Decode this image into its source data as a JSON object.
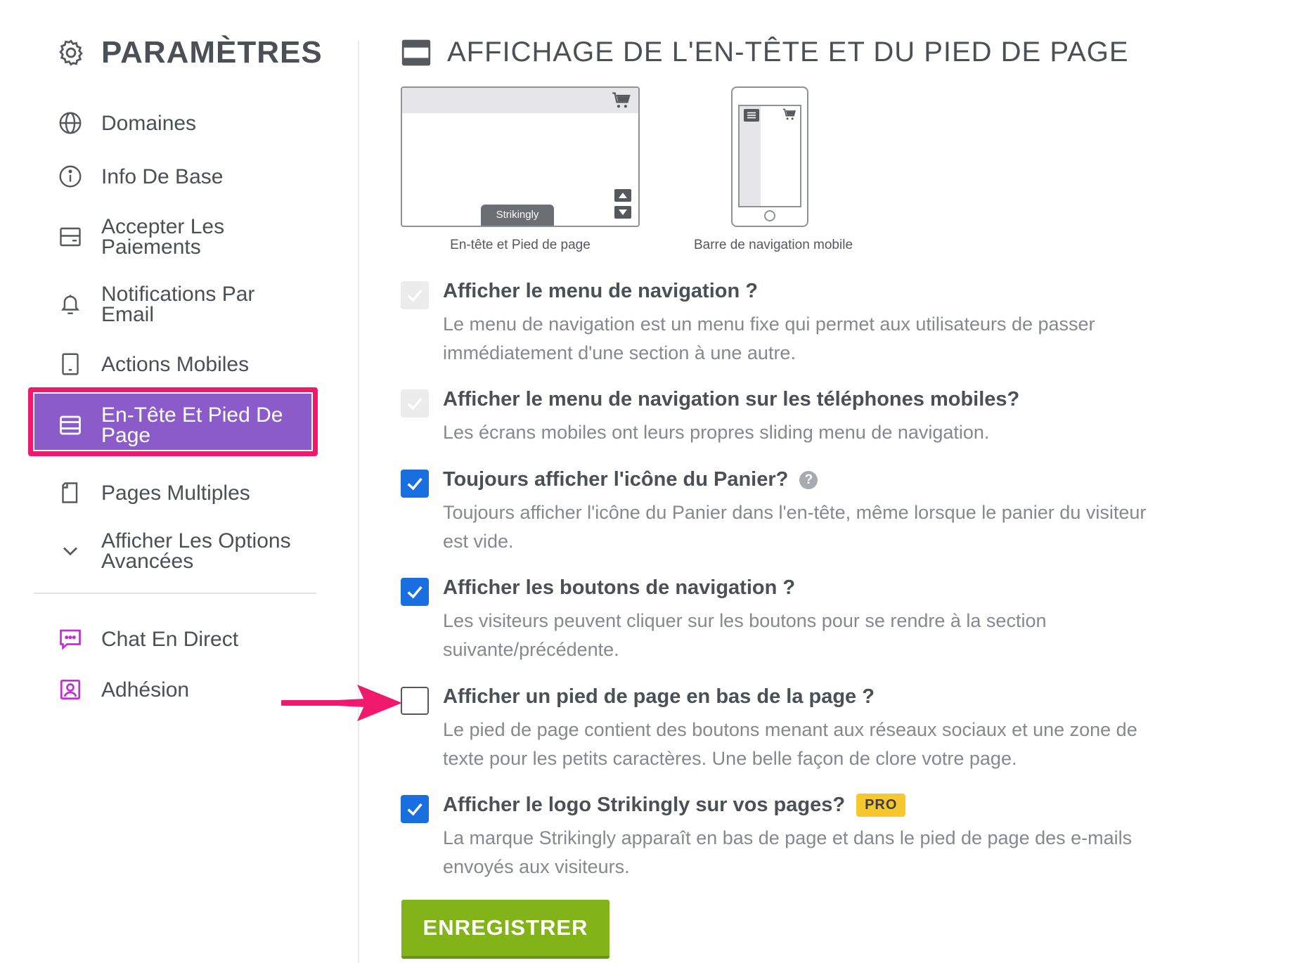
{
  "sidebar": {
    "title": "PARAMÈTRES",
    "items": [
      {
        "label_line1": "Domaines",
        "label_line2": "",
        "icon": "globe-icon"
      },
      {
        "label_line1": "Info De Base",
        "label_line2": "",
        "icon": "info-icon"
      },
      {
        "label_line1": "Accepter Les",
        "label_line2": "Paiements",
        "icon": "card-icon"
      },
      {
        "label_line1": "Notifications Par",
        "label_line2": "Email",
        "icon": "bell-icon"
      },
      {
        "label_line1": "Actions Mobiles",
        "label_line2": "",
        "icon": "tablet-icon"
      },
      {
        "label_line1": "En-Tête Et Pied De",
        "label_line2": "Page",
        "icon": "header-footer-icon",
        "active": true
      },
      {
        "label_line1": "Pages Multiples",
        "label_line2": "",
        "icon": "pages-icon"
      },
      {
        "label_line1": "Afficher Les Options",
        "label_line2": "Avancées",
        "icon": "chevron-down-icon"
      }
    ],
    "extras": [
      {
        "label": "Chat En Direct",
        "icon": "chat-icon",
        "color": "#c22fd1"
      },
      {
        "label": "Adhésion",
        "icon": "membership-icon",
        "color": "#c22fd1"
      }
    ]
  },
  "main": {
    "title": "AFFICHAGE DE L'EN-TÊTE ET DU PIED DE PAGE",
    "preview_desktop_caption": "En-tête et Pied de page",
    "preview_desktop_tab": "Strikingly",
    "preview_mobile_caption": "Barre de navigation mobile",
    "options": [
      {
        "title": "Afficher le menu de navigation ?",
        "desc_line1": "Le menu de navigation est un menu fixe qui permet aux utilisateurs de passer",
        "desc_line2": "immédiatement d'une section à une autre.",
        "state": "disabled-checked"
      },
      {
        "title": "Afficher le menu de navigation sur les téléphones mobiles?",
        "desc_line1": "Les écrans mobiles ont leurs propres sliding menu de navigation.",
        "desc_line2": "",
        "state": "disabled-checked"
      },
      {
        "title": "Toujours afficher l'icône du Panier?",
        "help": "?",
        "desc_line1": "Toujours afficher l'icône du Panier dans l'en-tête, même lorsque le panier du visiteur",
        "desc_line2": "est vide.",
        "state": "checked"
      },
      {
        "title": "Afficher les boutons de navigation ?",
        "desc_line1": "Les visiteurs peuvent cliquer sur les boutons pour se rendre à la section",
        "desc_line2": "suivante/précédente.",
        "state": "checked"
      },
      {
        "title": "Afficher un pied de page en bas de la page ?",
        "desc_line1": "Le pied de page contient des boutons menant aux réseaux sociaux et une zone de",
        "desc_line2": "texte pour les petits caractères. Une belle façon de clore votre page.",
        "state": "unchecked"
      },
      {
        "title": "Afficher le logo Strikingly sur vos pages?",
        "badge": "PRO",
        "desc_line1": "La marque Strikingly apparaît en bas de page et dans le pied de page des e-mails",
        "desc_line2": "envoyés aux visiteurs.",
        "state": "checked"
      }
    ],
    "save_label": "ENREGISTRER"
  },
  "colors": {
    "active_bg": "#8b5cc9",
    "highlight": "#f0196e",
    "checkbox": "#1a6fe0",
    "save": "#82b41a",
    "pro_badge": "#f7c730"
  }
}
